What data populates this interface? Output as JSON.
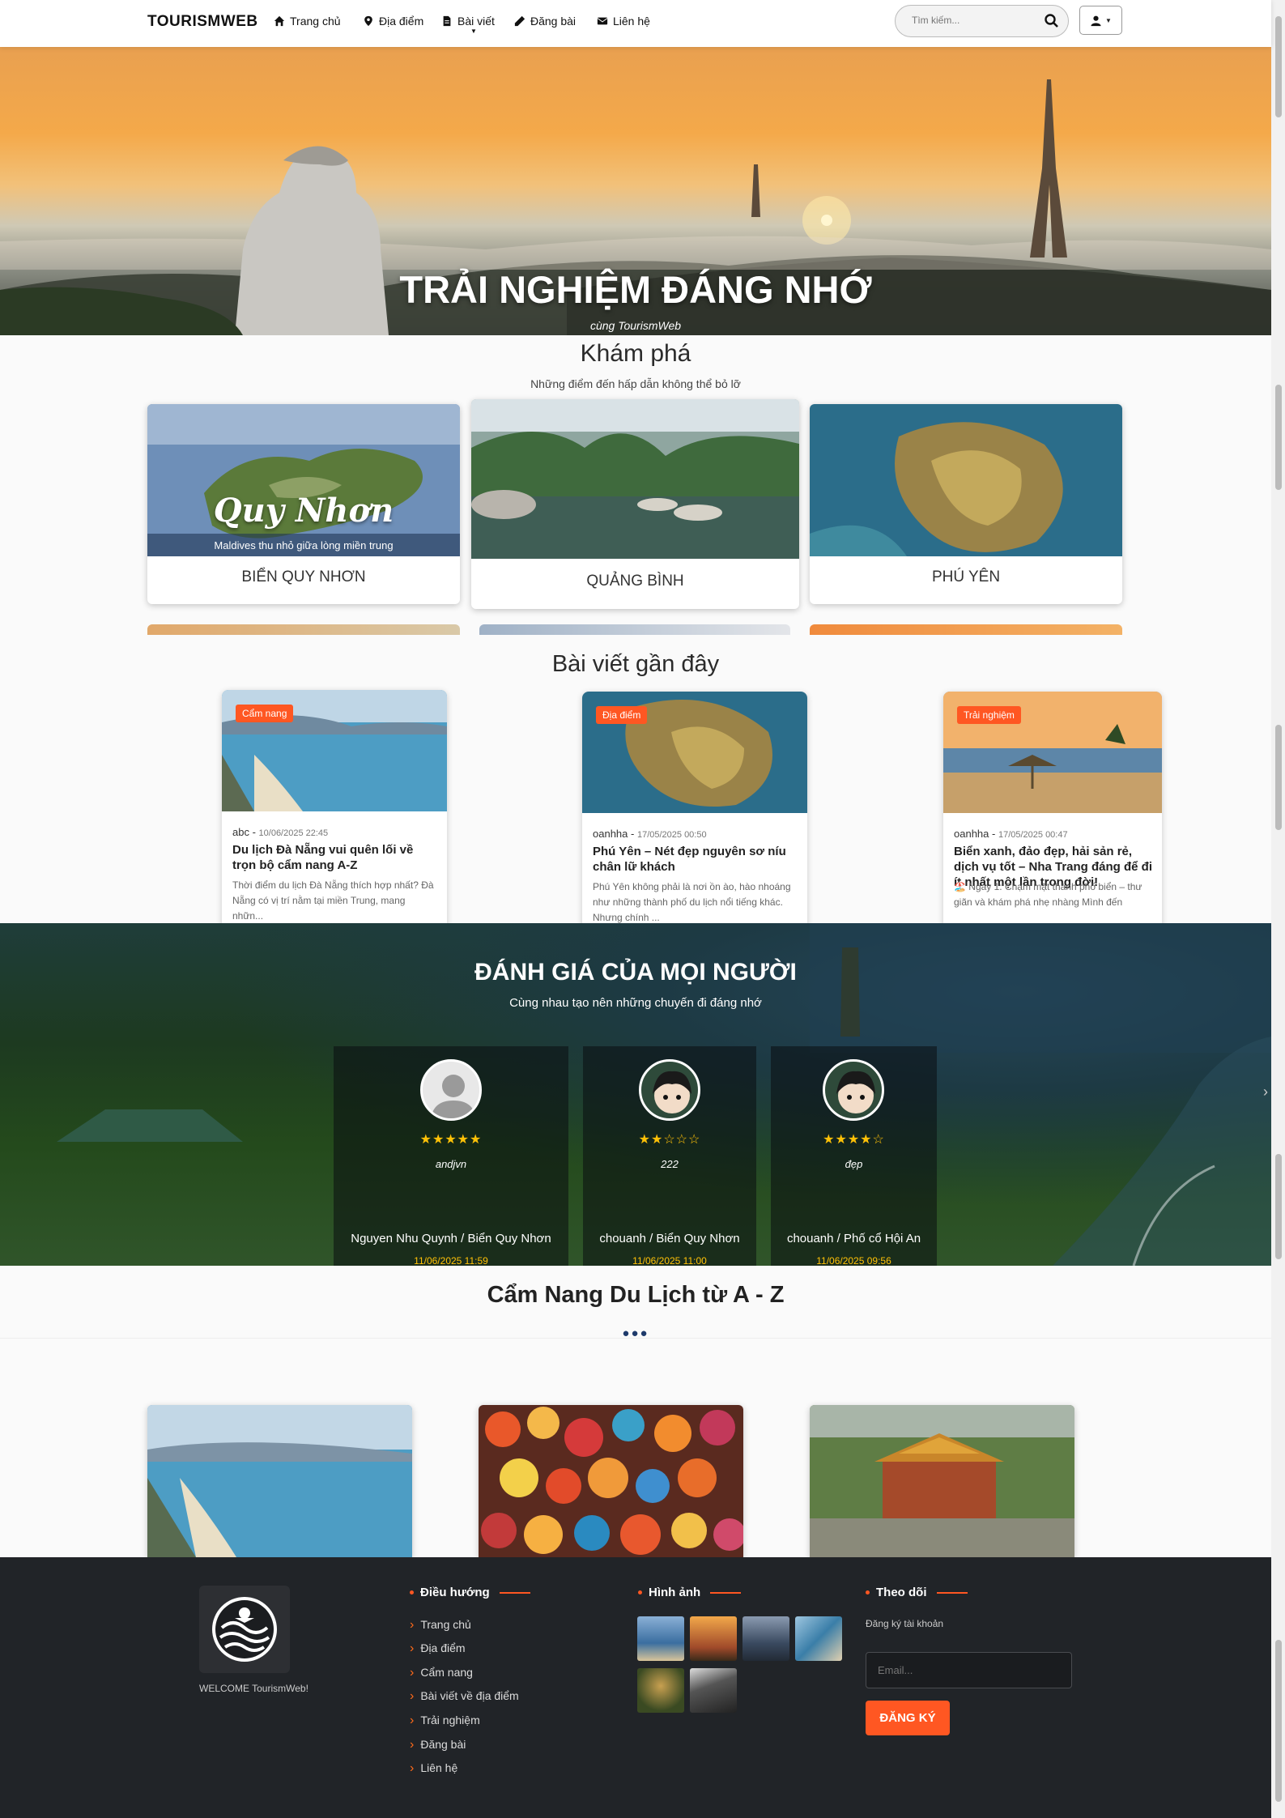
{
  "nav": {
    "brand": "TOURISMWEB",
    "items": [
      {
        "label": "Trang chủ",
        "icon": "home-icon"
      },
      {
        "label": "Địa điểm",
        "icon": "map-marker-icon"
      },
      {
        "label": "Bài viết",
        "icon": "file-icon"
      },
      {
        "label": "Đăng bài",
        "icon": "pencil-icon"
      },
      {
        "label": "Liên hệ",
        "icon": "envelope-icon"
      }
    ],
    "search_placeholder": "Tìm kiếm...",
    "user_icon": "user-icon"
  },
  "hero": {
    "title": "TRẢI NGHIỆM ĐÁNG NHỚ",
    "subtitle": "cùng TourismWeb"
  },
  "explore": {
    "title": "Khám phá",
    "subtitle": "Những điểm đến hấp dẫn không thể bỏ lỡ",
    "cards": [
      {
        "name": "BIỂN QUY NHƠN",
        "overlay_title": "Quy Nhơn",
        "overlay_sub": "Maldives thu nhỏ giữa lòng miền trung"
      },
      {
        "name": "QUẢNG BÌNH"
      },
      {
        "name": "PHÚ YÊN"
      }
    ]
  },
  "recent": {
    "title": "Bài viết gần đây",
    "posts": [
      {
        "tag": "Cẩm nang",
        "author": "abc",
        "date": "10/06/2025 22:45",
        "title": "Du lịch Đà Nẵng vui quên lối về trọn bộ cẩm nang A-Z",
        "excerpt": "Thời điểm du lịch Đà Nẵng thích hợp nhất? Đà Nẵng có vị trí nằm tại miền Trung, mang nhữn..."
      },
      {
        "tag": "Địa điểm",
        "author": "oanhha",
        "date": "17/05/2025 00:50",
        "title": "Phú Yên – Nét đẹp nguyên sơ níu chân lữ khách",
        "excerpt": "Phú Yên không phải là nơi ồn ào, hào nhoáng như những thành phố du lịch nổi tiếng khác. Nhưng chính ..."
      },
      {
        "tag": "Trải nghiệm",
        "author": "oanhha",
        "date": "17/05/2025 00:47",
        "title": "Biển xanh, đảo đẹp, hải sản rẻ, dịch vụ tốt – Nha Trang đáng để đi ít nhất một lần trong đời!",
        "excerpt": "🏖️ Ngày 1: Chạm mặt thành phố biển – thư giãn và khám phá nhẹ nhàng Mình đến"
      }
    ]
  },
  "reviews": {
    "title": "ĐÁNH GIÁ CỦA MỌI NGƯỜI",
    "subtitle": "Cùng nhau tạo nên những chuyến đi đáng nhớ",
    "items": [
      {
        "stars": "★★★★★",
        "rating": 5,
        "text": "andjvn",
        "name": "Nguyen Nhu Quynh / Biển Quy Nhơn",
        "date": "11/06/2025 11:59"
      },
      {
        "stars": "★★☆☆☆",
        "rating": 2,
        "text": "222",
        "name": "chouanh / Biển Quy Nhơn",
        "date": "11/06/2025 11:00"
      },
      {
        "stars": "★★★★☆",
        "rating": 4,
        "text": "đẹp",
        "name": "chouanh / Phố cổ Hội An",
        "date": "11/06/2025 09:56"
      }
    ]
  },
  "guide": {
    "title": "Cẩm Nang Du Lịch từ A - Z",
    "dots": "●●●"
  },
  "footer": {
    "welcome": "WELCOME TourismWeb!",
    "nav_title": "Điều hướng",
    "links": [
      "Trang chủ",
      "Địa điểm",
      "Cẩm nang",
      "Bài viết về địa điểm",
      "Trải nghiệm",
      "Đăng bài",
      "Liên hệ"
    ],
    "images_title": "Hình ảnh",
    "follow_title": "Theo dõi",
    "follow_text": "Đăng ký tài khoản",
    "email_placeholder": "Email...",
    "signup_label": "ĐĂNG KÝ"
  },
  "colors": {
    "accent": "#ff5722",
    "footer_bg": "#212428",
    "star": "#ffc107"
  }
}
